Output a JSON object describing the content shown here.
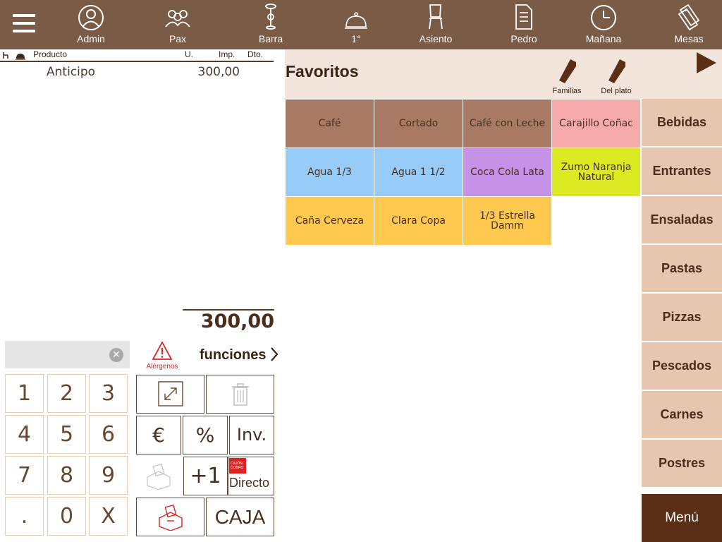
{
  "topbar": {
    "items": [
      {
        "label": "Admin",
        "icon": "user-icon"
      },
      {
        "label": "Pax",
        "icon": "people-icon"
      },
      {
        "label": "Barra",
        "icon": "bar-stool-icon"
      },
      {
        "label": "1°",
        "icon": "cloche-icon"
      },
      {
        "label": "Asiento",
        "icon": "chair-icon"
      },
      {
        "label": "Pedro",
        "icon": "waiter-document-icon"
      },
      {
        "label": "Mañana",
        "icon": "clock-icon"
      },
      {
        "label": "Mesas",
        "icon": "tags-icon"
      }
    ]
  },
  "ticket": {
    "headers": {
      "producto": "Producto",
      "unidades": "U.",
      "importe": "Imp.",
      "descuento": "Dto."
    },
    "lines": [
      {
        "producto": "Anticipo",
        "importe": "300,00"
      }
    ],
    "total": "300,00"
  },
  "keypad": {
    "display_value": "",
    "clear_icon": "⊗",
    "keys": [
      "1",
      "2",
      "3",
      "4",
      "5",
      "6",
      "7",
      "8",
      "9",
      ".",
      "0",
      "X"
    ]
  },
  "functions": {
    "alergenos_label": "Alérgenos",
    "funciones_label": "funciones",
    "euro_label": "€",
    "percent_label": "%",
    "inv_label": "Inv.",
    "plus_one_label": "+1",
    "directo_label": "Directo",
    "directo_badge": "CAJÓN COBRO",
    "caja_label": "CAJA"
  },
  "favorites": {
    "title": "Favoritos",
    "familias_label": "Familias",
    "del_plato_label": "Del plato",
    "colors": {
      "brown": "#a97b64",
      "pink": "#f7aaaa",
      "blue": "#96ccf7",
      "purple": "#c592e8",
      "lime": "#dcea24",
      "yellow": "#fec94e"
    },
    "products": [
      {
        "name": "Café",
        "color": "#a97b64"
      },
      {
        "name": "Cortado",
        "color": "#a97b64"
      },
      {
        "name": "Café con Leche",
        "color": "#a97b64"
      },
      {
        "name": "Carajillo Coñac",
        "color": "#f7aaaa"
      },
      {
        "name": "Agua 1/3",
        "color": "#96ccf7"
      },
      {
        "name": "Agua 1 1/2",
        "color": "#96ccf7"
      },
      {
        "name": "Coca Cola Lata",
        "color": "#c592e8"
      },
      {
        "name": "Zumo Naranja Natural",
        "color": "#dcea24"
      },
      {
        "name": "Caña Cerveza",
        "color": "#fec94e"
      },
      {
        "name": "Clara Copa",
        "color": "#fec94e"
      },
      {
        "name": "1/3 Estrella Damm",
        "color": "#fec94e"
      }
    ]
  },
  "categories": [
    "Bebidas",
    "Entrantes",
    "Ensaladas",
    "Pastas",
    "Pizzas",
    "Pescados",
    "Carnes",
    "Postres"
  ],
  "menu_label": "Menú"
}
